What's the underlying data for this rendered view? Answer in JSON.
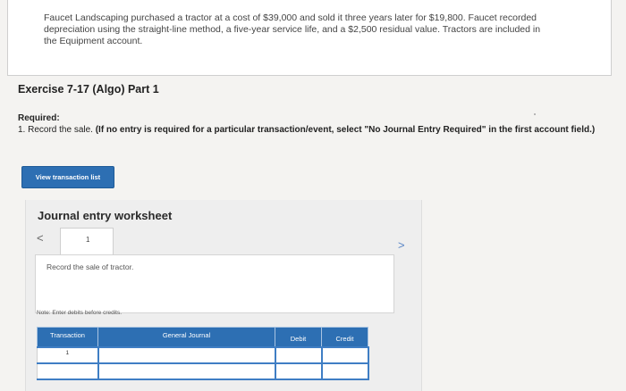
{
  "problem": {
    "line1": "Faucet Landscaping purchased a tractor at a cost of $39,000 and sold it three years later for $19,800. Faucet recorded",
    "line2": "depreciation using the straight-line method, a five-year service life, and a $2,500 residual value. Tractors are included in",
    "line3": "the Equipment account."
  },
  "exercise_title": "Exercise 7-17 (Algo) Part 1",
  "required": {
    "label": "Required:",
    "item": "1. Record the sale.",
    "note": "(If no entry is required for a particular transaction/event, select \"No Journal Entry Required\" in the first account field.)"
  },
  "view_transaction_button": "View transaction list",
  "worksheet": {
    "title": "Journal entry worksheet",
    "prev": "<",
    "next": ">",
    "tab": "1",
    "description": "Record the sale of tractor.",
    "note": "Note: Enter debits before credits.",
    "columns": [
      "Transaction",
      "General Journal",
      "Debit",
      "Credit"
    ],
    "rows": [
      {
        "transaction": "1",
        "account": "",
        "debit": "",
        "credit": ""
      },
      {
        "transaction": "",
        "account": "",
        "debit": "",
        "credit": ""
      }
    ]
  }
}
